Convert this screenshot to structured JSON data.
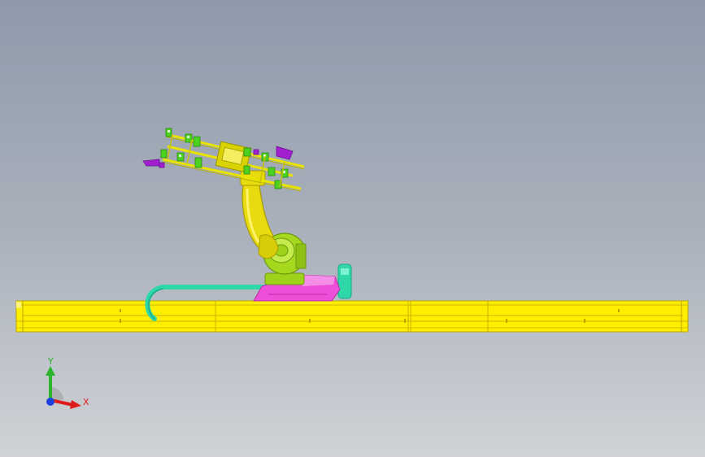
{
  "viewport": {
    "background_top": "#8e9aab",
    "background_bottom": "#d0d2d6"
  },
  "model": {
    "rail_color": "#ffee00",
    "rail_edge_color": "#b8a800",
    "robot_arm_color": "#e8dc10",
    "robot_base_color": "#9fd21a",
    "pedestal_color": "#ee4fd8",
    "cable_carrier_color": "#2fd8a8",
    "gripper_accent_color": "#a020d0"
  },
  "triad": {
    "x_label": "X",
    "y_label": "Y",
    "x_color": "#dd1c1c",
    "y_color": "#2bb52b",
    "z_color": "#1c3fdd"
  }
}
